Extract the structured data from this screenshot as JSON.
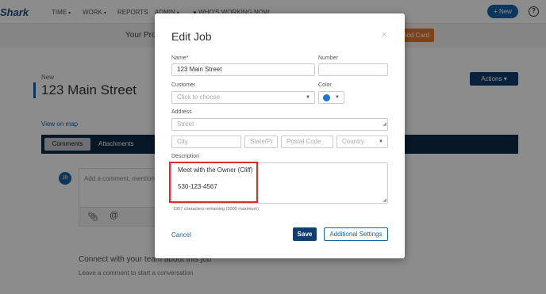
{
  "app": {
    "logo_text": "Shark",
    "nav": [
      {
        "label": "TIME",
        "dropdown": true
      },
      {
        "label": "WORK",
        "dropdown": true
      },
      {
        "label": "REPORTS",
        "dropdown": false
      },
      {
        "label": "ADMIN",
        "dropdown": true
      },
      {
        "label": "WHO'S WORKING NOW",
        "dropdown": false
      }
    ],
    "new_button": "+ New",
    "help_icon": "?",
    "banner_text": "Your Pro",
    "add_card_button": "Add Card",
    "page_label": "New",
    "page_title": "123 Main Street",
    "actions_button": "Actions",
    "view_on_map": "View on map",
    "tabs": {
      "comments": "Comments",
      "attachments": "Attachments"
    },
    "avatar_initials": "JR",
    "comment_placeholder": "Add a comment, mention",
    "connect_title": "Connect with your team about this job",
    "connect_sub": "Leave a comment to start a conversation"
  },
  "modal": {
    "title": "Edit Job",
    "close_icon": "×",
    "name": {
      "label": "Name",
      "required_mark": "*",
      "value": "123 Main Street"
    },
    "number": {
      "label": "Number",
      "value": ""
    },
    "customer": {
      "label": "Customer",
      "placeholder": "Click to choose"
    },
    "color": {
      "label": "Color",
      "value": "#1b74d6"
    },
    "address": {
      "label": "Address",
      "street_placeholder": "Street",
      "city_placeholder": "City",
      "state_placeholder": "State/Pr",
      "postal_placeholder": "Postal Code",
      "country_placeholder": "Country"
    },
    "description": {
      "label": "Description",
      "line1": "Meet with the Owner (Cliff)",
      "line2": "530-123-4567",
      "chars_remaining": "1957 characters remaining (2000 maximum)"
    },
    "cancel": "Cancel",
    "save": "Save",
    "additional_settings": "Additional Settings"
  },
  "colors": {
    "primary": "#0f3f70",
    "link": "#1565a8",
    "highlight": "#d32f2f",
    "accent_orange": "#e8792b"
  }
}
